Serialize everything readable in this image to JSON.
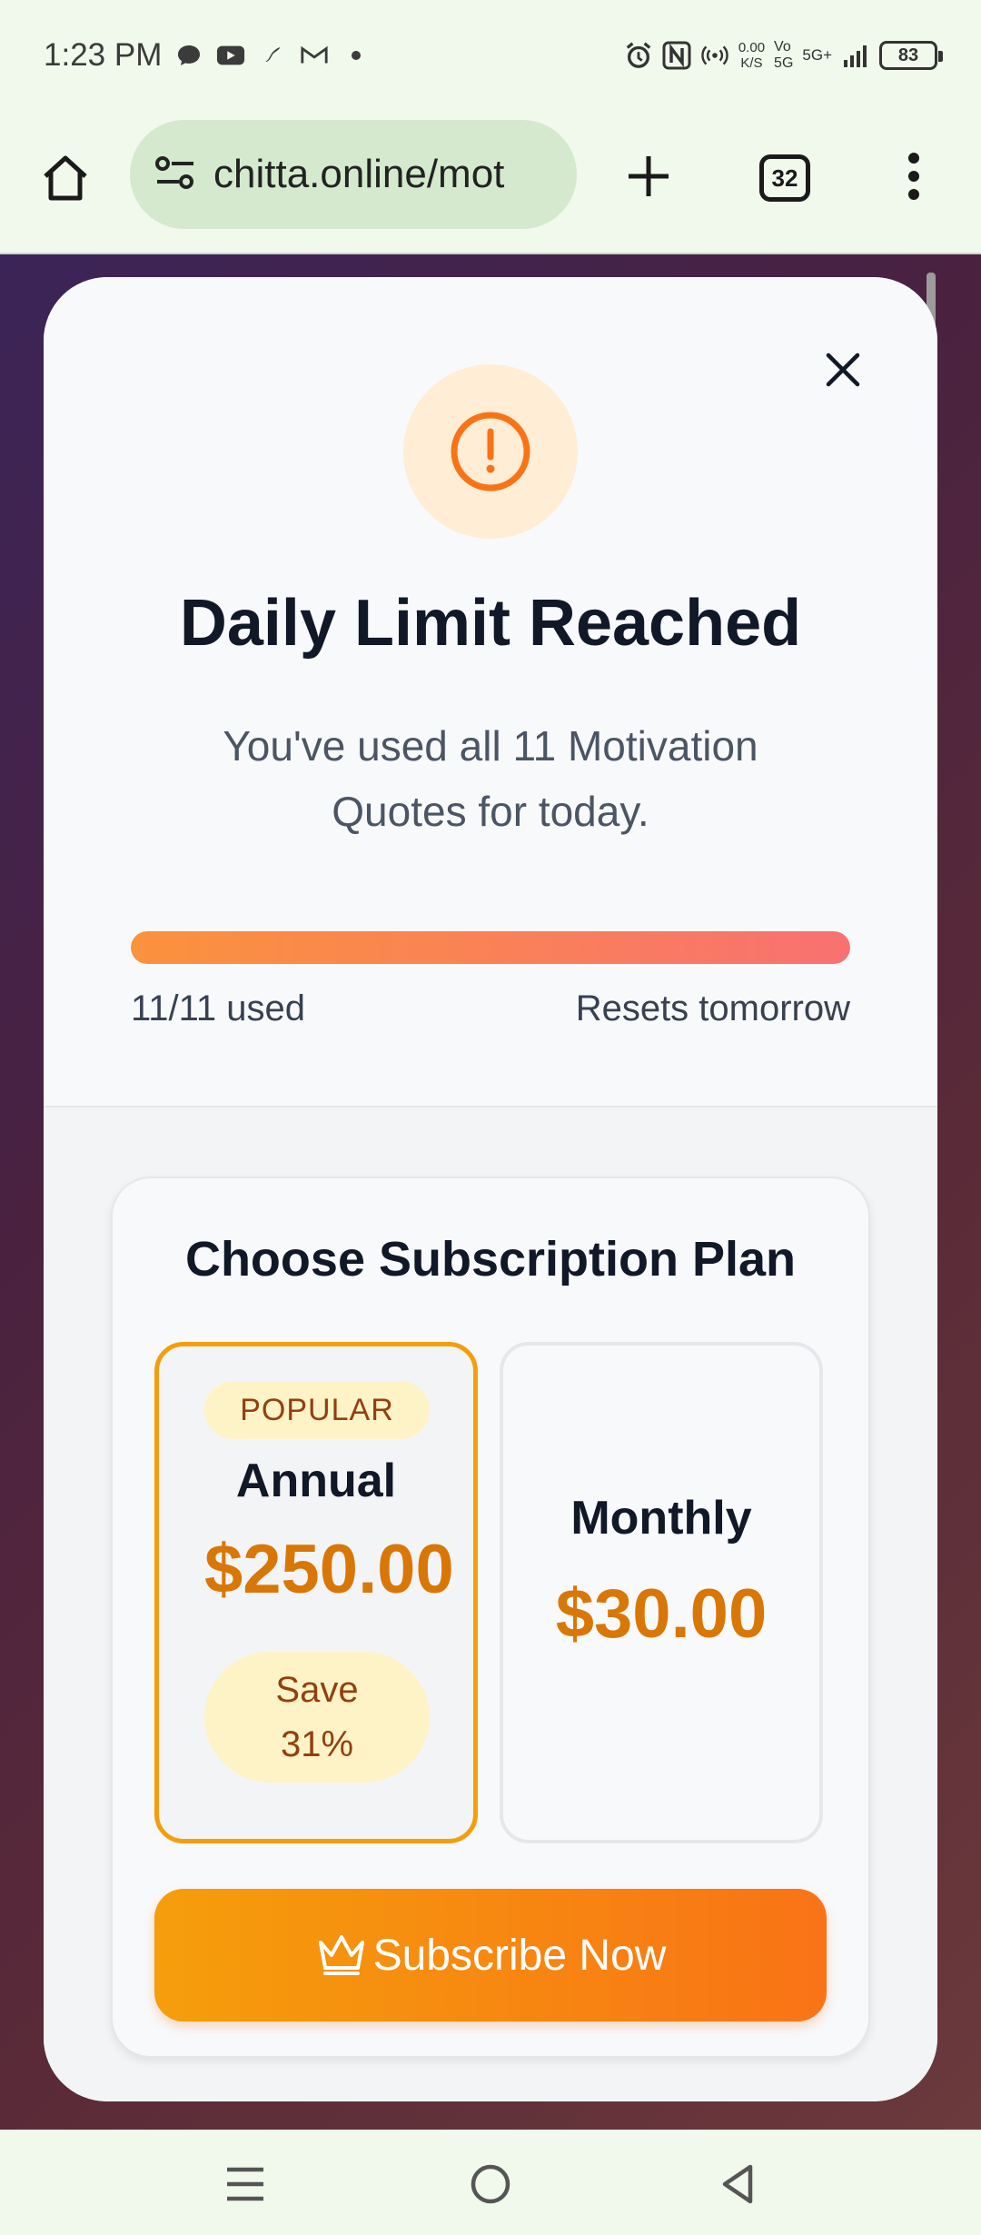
{
  "status_bar": {
    "time": "1:23 PM",
    "net_speed_value": "0.00",
    "net_speed_unit": "K/S",
    "network_label_1": "Vo\n5G",
    "network_label_2": "5G+",
    "battery": "83",
    "notification_icons": [
      "chat-icon",
      "youtube-icon",
      "tinder-icon",
      "gmail-icon",
      "dot-icon"
    ],
    "system_icons": [
      "alarm-icon",
      "nfc-icon",
      "hotspot-icon",
      "signal-icon",
      "battery-icon"
    ]
  },
  "browser": {
    "url": "chitta.online/mot",
    "tab_count": "32"
  },
  "modal": {
    "title": "Daily Limit Reached",
    "subtitle": "You've used all 11 Motivation Quotes for today.",
    "progress": {
      "used_label": "11/11 used",
      "reset_label": "Resets tomorrow",
      "fraction": 1.0
    },
    "colors": {
      "accent": "#f97316",
      "price": "#d97706",
      "selected_border": "#f59e0b"
    }
  },
  "plans": {
    "title": "Choose Subscription Plan",
    "options": [
      {
        "name": "Annual",
        "price": "$250.00",
        "badge": "POPULAR",
        "save": "Save 31%",
        "selected": true
      },
      {
        "name": "Monthly",
        "price": "$30.00",
        "selected": false
      }
    ],
    "cta": "Subscribe Now",
    "cta_icon": "crown-icon"
  },
  "nav": {
    "buttons": [
      "recents-icon",
      "home-circle-icon",
      "back-icon"
    ]
  }
}
